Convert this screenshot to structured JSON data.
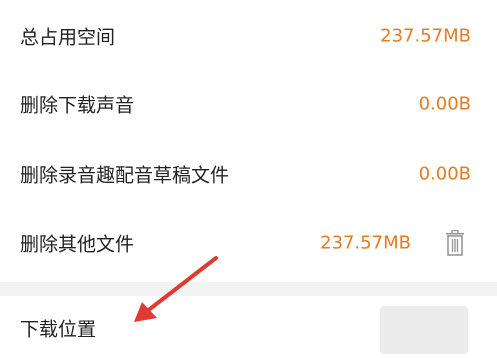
{
  "storage": {
    "total": {
      "label": "总占用空间",
      "value": "237.57MB"
    },
    "download_audio": {
      "label": "删除下载声音",
      "value": "0.00B"
    },
    "draft_files": {
      "label": "删除录音趣配音草稿文件",
      "value": "0.00B"
    },
    "other_files": {
      "label": "删除其他文件",
      "value": "237.57MB",
      "icon": "trash-icon"
    }
  },
  "download_location": {
    "label": "下载位置"
  },
  "colors": {
    "value_orange": "#e87a23",
    "arrow_red": "#e03a32",
    "text_dark": "#222222"
  }
}
